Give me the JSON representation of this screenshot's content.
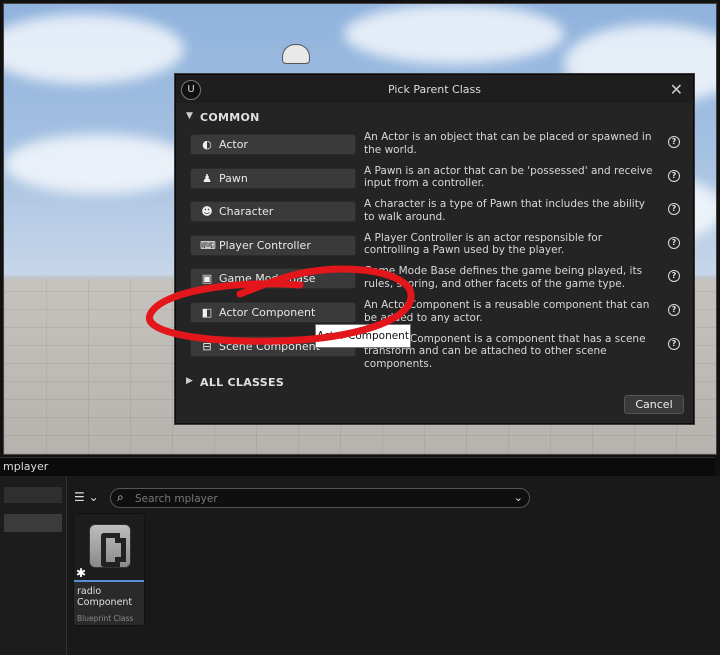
{
  "dialog": {
    "title": "Pick Parent Class",
    "close_symbol": "✕",
    "logo_text": "U",
    "common_header": "COMMON",
    "all_classes_header": "ALL CLASSES",
    "cancel_label": "Cancel",
    "classes": [
      {
        "label": "Actor",
        "icon": "actor-icon",
        "glyph": "◐",
        "description": "An Actor is an object that can be placed or spawned in the world."
      },
      {
        "label": "Pawn",
        "icon": "pawn-icon",
        "glyph": "♟",
        "description": "A Pawn is an actor that can be 'possessed' and receive input from a controller."
      },
      {
        "label": "Character",
        "icon": "character-icon",
        "glyph": "☻",
        "description": "A character is a type of Pawn that includes the ability to walk around."
      },
      {
        "label": "Player Controller",
        "icon": "gamepad-icon",
        "glyph": "⌨",
        "description": "A Player Controller is an actor responsible for controlling a Pawn used by the player."
      },
      {
        "label": "Game Mode Base",
        "icon": "game-mode-icon",
        "glyph": "▣",
        "description": "Game Mode Base defines the game being played, its rules, scoring, and other facets of the game type."
      },
      {
        "label": "Actor Component",
        "icon": "actor-component-icon",
        "glyph": "◧",
        "description": "An ActorComponent is a reusable component that can be added to any actor."
      },
      {
        "label": "Scene Component",
        "icon": "scene-component-icon",
        "glyph": "⊟",
        "description": "A Scene Component is a component that has a scene transform and can be attached to other scene components."
      }
    ],
    "help_symbol": "?"
  },
  "tooltip": "Actor Component",
  "content_browser": {
    "path": "mplayer",
    "filter_symbol": "☰ ⌄",
    "search_placeholder": "Search mplayer",
    "search_dropdown": "⌄",
    "asset": {
      "name": "radio Component",
      "type": "Blueprint Class"
    }
  },
  "colors": {
    "annotation": "#e3161b",
    "dialog_bg": "#242424",
    "button_bg": "#3a3a3a",
    "asset_underline": "#5b8ccf"
  }
}
